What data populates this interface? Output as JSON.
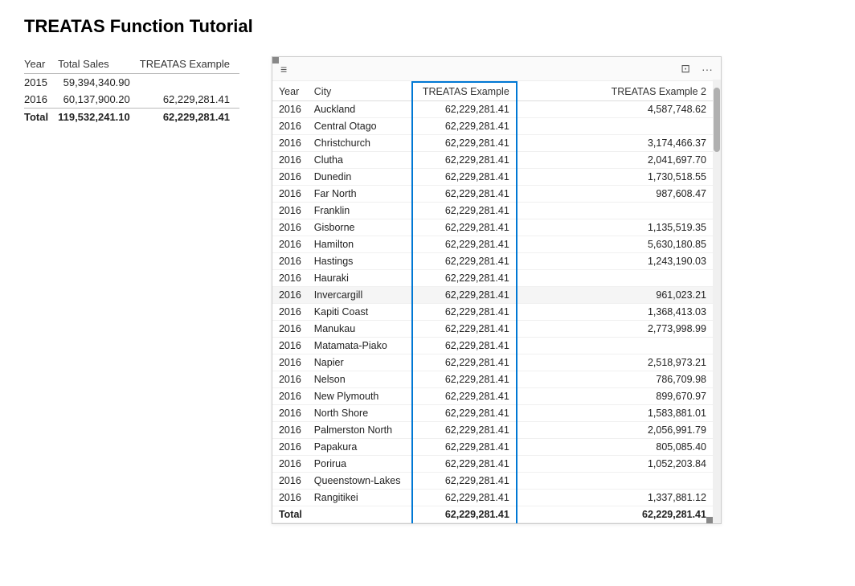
{
  "page": {
    "title": "TREATAS Function Tutorial"
  },
  "left_table": {
    "headers": [
      "Year",
      "Total Sales",
      "TREATAS Example"
    ],
    "rows": [
      {
        "year": "2015",
        "total_sales": "59,394,340.90",
        "treatas": ""
      },
      {
        "year": "2016",
        "total_sales": "60,137,900.20",
        "treatas": "62,229,281.41"
      }
    ],
    "total": {
      "label": "Total",
      "total_sales": "119,532,241.10",
      "treatas": "62,229,281.41"
    }
  },
  "right_table": {
    "toolbar": {
      "expand_icon": "⊡",
      "more_icon": "···"
    },
    "headers": [
      "Year",
      "City",
      "TREATAS Example",
      "TREATAS Example 2"
    ],
    "rows": [
      {
        "year": "2016",
        "city": "Auckland",
        "treatas": "62,229,281.41",
        "treatas2": "4,587,748.62"
      },
      {
        "year": "2016",
        "city": "Central Otago",
        "treatas": "62,229,281.41",
        "treatas2": ""
      },
      {
        "year": "2016",
        "city": "Christchurch",
        "treatas": "62,229,281.41",
        "treatas2": "3,174,466.37"
      },
      {
        "year": "2016",
        "city": "Clutha",
        "treatas": "62,229,281.41",
        "treatas2": "2,041,697.70"
      },
      {
        "year": "2016",
        "city": "Dunedin",
        "treatas": "62,229,281.41",
        "treatas2": "1,730,518.55"
      },
      {
        "year": "2016",
        "city": "Far North",
        "treatas": "62,229,281.41",
        "treatas2": "987,608.47"
      },
      {
        "year": "2016",
        "city": "Franklin",
        "treatas": "62,229,281.41",
        "treatas2": ""
      },
      {
        "year": "2016",
        "city": "Gisborne",
        "treatas": "62,229,281.41",
        "treatas2": "1,135,519.35"
      },
      {
        "year": "2016",
        "city": "Hamilton",
        "treatas": "62,229,281.41",
        "treatas2": "5,630,180.85"
      },
      {
        "year": "2016",
        "city": "Hastings",
        "treatas": "62,229,281.41",
        "treatas2": "1,243,190.03"
      },
      {
        "year": "2016",
        "city": "Hauraki",
        "treatas": "62,229,281.41",
        "treatas2": ""
      },
      {
        "year": "2016",
        "city": "Invercargill",
        "treatas": "62,229,281.41",
        "treatas2": "961,023.21",
        "shaded": true
      },
      {
        "year": "2016",
        "city": "Kapiti Coast",
        "treatas": "62,229,281.41",
        "treatas2": "1,368,413.03"
      },
      {
        "year": "2016",
        "city": "Manukau",
        "treatas": "62,229,281.41",
        "treatas2": "2,773,998.99"
      },
      {
        "year": "2016",
        "city": "Matamata-Piako",
        "treatas": "62,229,281.41",
        "treatas2": ""
      },
      {
        "year": "2016",
        "city": "Napier",
        "treatas": "62,229,281.41",
        "treatas2": "2,518,973.21"
      },
      {
        "year": "2016",
        "city": "Nelson",
        "treatas": "62,229,281.41",
        "treatas2": "786,709.98"
      },
      {
        "year": "2016",
        "city": "New Plymouth",
        "treatas": "62,229,281.41",
        "treatas2": "899,670.97"
      },
      {
        "year": "2016",
        "city": "North Shore",
        "treatas": "62,229,281.41",
        "treatas2": "1,583,881.01"
      },
      {
        "year": "2016",
        "city": "Palmerston North",
        "treatas": "62,229,281.41",
        "treatas2": "2,056,991.79"
      },
      {
        "year": "2016",
        "city": "Papakura",
        "treatas": "62,229,281.41",
        "treatas2": "805,085.40"
      },
      {
        "year": "2016",
        "city": "Porirua",
        "treatas": "62,229,281.41",
        "treatas2": "1,052,203.84"
      },
      {
        "year": "2016",
        "city": "Queenstown-Lakes",
        "treatas": "62,229,281.41",
        "treatas2": ""
      },
      {
        "year": "2016",
        "city": "Rangitikei",
        "treatas": "62,229,281.41",
        "treatas2": "1,337,881.12"
      }
    ],
    "total": {
      "label": "Total",
      "treatas": "62,229,281.41",
      "treatas2": "62,229,281.41"
    }
  },
  "icons": {
    "expand": "⊡",
    "more": "···",
    "drag": "≡"
  }
}
